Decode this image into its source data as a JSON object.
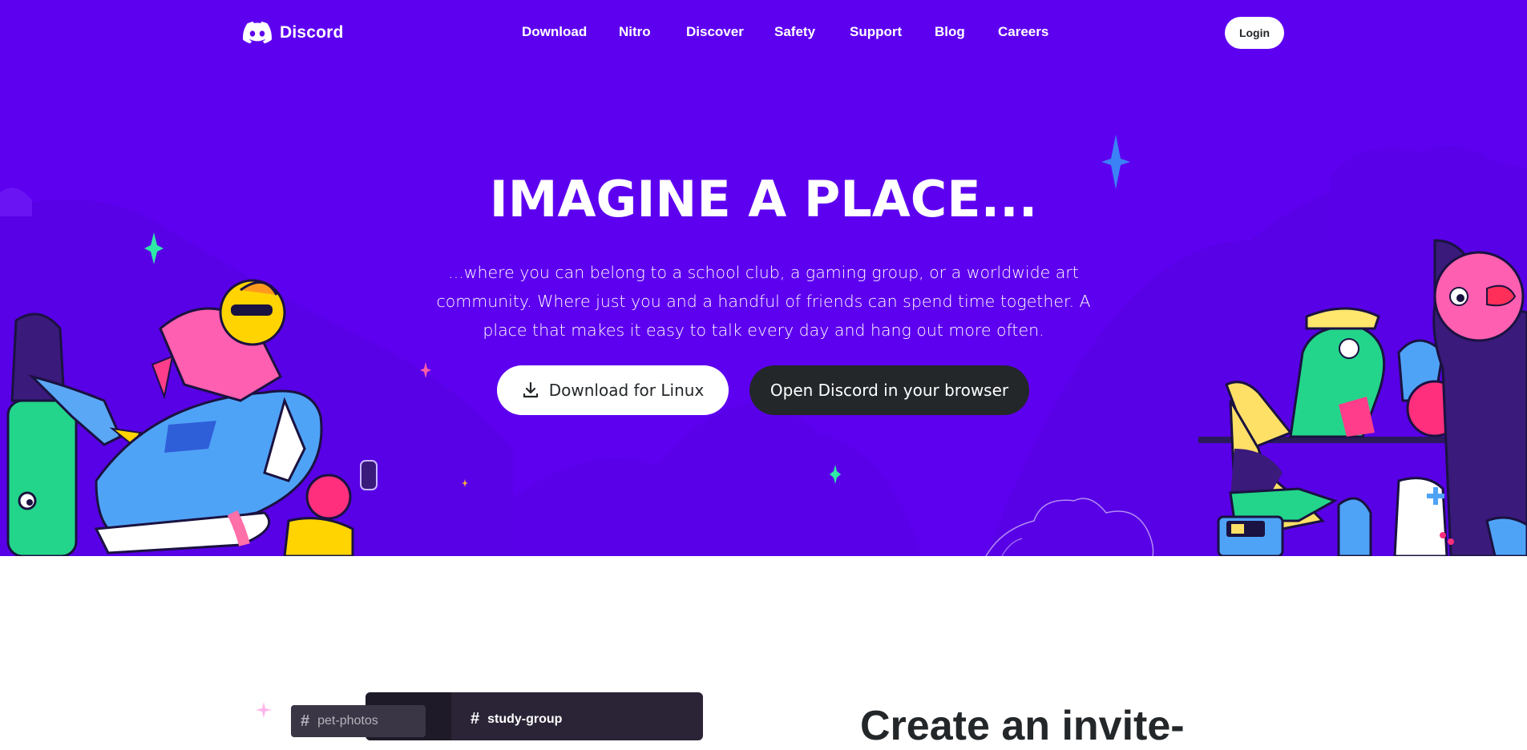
{
  "brand": {
    "name": "Discord"
  },
  "nav": {
    "items": [
      {
        "label": "Download"
      },
      {
        "label": "Nitro"
      },
      {
        "label": "Discover"
      },
      {
        "label": "Safety"
      },
      {
        "label": "Support"
      },
      {
        "label": "Blog"
      },
      {
        "label": "Careers"
      }
    ],
    "login_label": "Login"
  },
  "hero": {
    "headline": "IMAGINE A PLACE...",
    "subtext": "...where you can belong to a school club, a gaming group, or a worldwide art community. Where just you and a handful of friends can spend time together. A place that makes it easy to talk every day and hang out more often.",
    "download_button": "Download for Linux",
    "browser_button": "Open Discord in your browser"
  },
  "feature": {
    "channels": [
      "pet-photos",
      "study-group"
    ],
    "title": "Create an invite-"
  },
  "colors": {
    "hero_bg": "#5e00f0",
    "dark_button": "#23272a",
    "white": "#ffffff"
  },
  "icons": [
    "discord-logo-icon",
    "download-icon",
    "hash-icon",
    "sparkle-icon"
  ]
}
